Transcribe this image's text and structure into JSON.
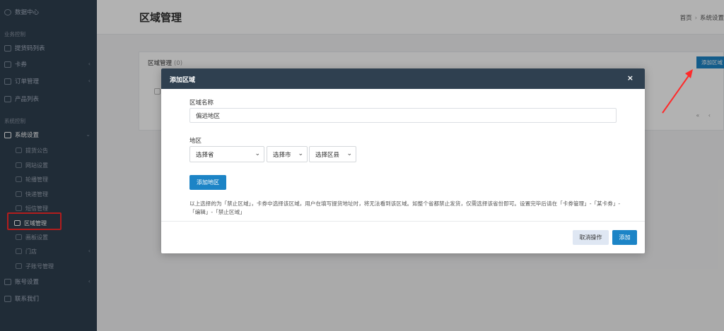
{
  "sidebar": {
    "top_item": "数据中心",
    "section_business": "业务控制",
    "business_items": [
      "提货码列表",
      "卡券",
      "订单管理",
      "产品列表"
    ],
    "section_system": "系统控制",
    "system_settings": "系统设置",
    "system_sub_items": [
      "提货公告",
      "网站设置",
      "轮播管理",
      "快递管理",
      "短信管理",
      "区域管理",
      "画板设置",
      "门店",
      "子账号管理"
    ],
    "account_settings": "账号设置",
    "contact_us": "联系我们"
  },
  "header": {
    "title": "区域管理",
    "breadcrumb_home": "首页",
    "breadcrumb_current": "系统设置"
  },
  "panel": {
    "title": "区域管理",
    "count": "(0)",
    "add_button": "添加区域",
    "pager_first": "«",
    "pager_prev": "‹"
  },
  "modal": {
    "title": "添加区域",
    "close": "×",
    "name_label": "区域名称",
    "name_value": "偏远地区",
    "region_label": "地区",
    "province_select": "选择省",
    "city_select": "选择市",
    "district_select": "选择区县",
    "add_area_button": "添加地区",
    "note": "以上选择的为「禁止区域」，卡券中选择该区域，用户在填写提货地址时，将无法看到该区域。如整个省都禁止发货，仅需选择该省份即可。设置完毕后请在「卡券管理」-「某卡券」-「编辑」-「禁止区域」",
    "cancel_button": "取消操作",
    "submit_button": "添加"
  },
  "colors": {
    "sidebar_bg": "#2f4050",
    "primary": "#1c84c6",
    "highlight": "#ff2a2a"
  }
}
